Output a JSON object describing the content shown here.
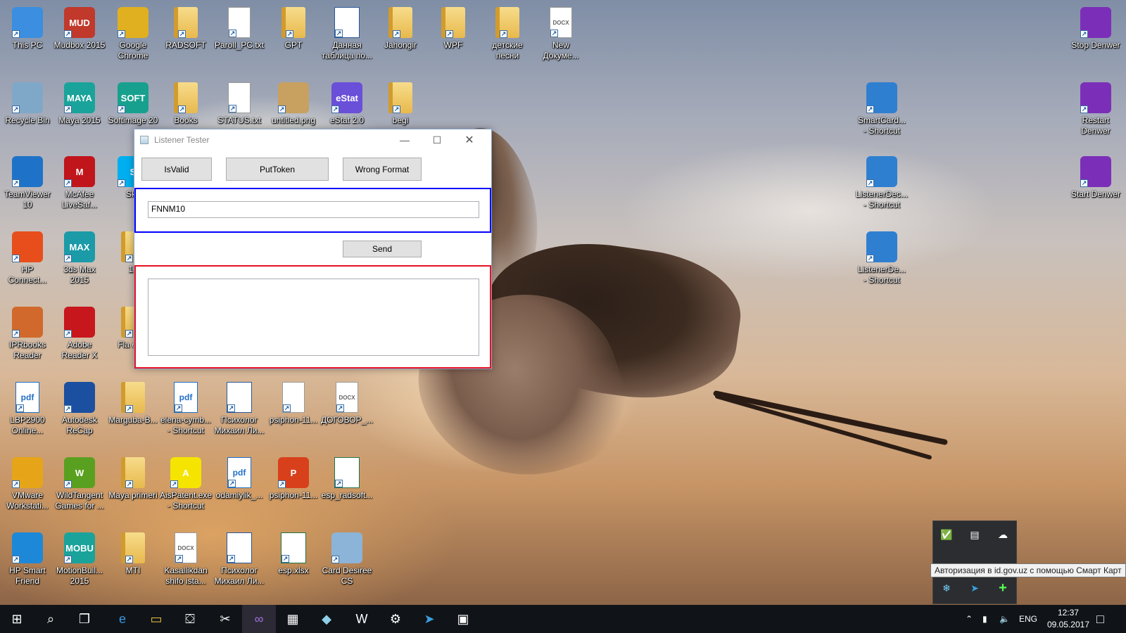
{
  "desktop_icons": [
    {
      "label": "This PC",
      "icon": "this-pc-icon"
    },
    {
      "label": "Mudbox 2015",
      "icon": "mudbox-icon",
      "badge": "MUD"
    },
    {
      "label": "Google Chrome",
      "icon": "chrome-icon"
    },
    {
      "label": "RADSOFT",
      "icon": "folder-icon"
    },
    {
      "label": "Paroll_PC.txt",
      "icon": "text-file-icon"
    },
    {
      "label": "GPT",
      "icon": "folder-icon"
    },
    {
      "label": "Данная таблица по...",
      "icon": "word-doc-icon"
    },
    {
      "label": "Jahongir",
      "icon": "folder-icon"
    },
    {
      "label": "WPF",
      "icon": "folder-icon"
    },
    {
      "label": "детские песни",
      "icon": "folder-icon"
    },
    {
      "label": "New Докуме...",
      "icon": "docx-icon",
      "badge": "DOCX"
    },
    {
      "label": "Stop Denwer",
      "icon": "denwer-stop-icon"
    },
    {
      "label": "Recycle Bin",
      "icon": "recycle-bin-icon"
    },
    {
      "label": "Maya 2015",
      "icon": "maya-icon",
      "badge": "MAYA"
    },
    {
      "label": "Softimage 20",
      "icon": "softimage-icon",
      "badge": "SOFT"
    },
    {
      "label": "Books",
      "icon": "folder-icon"
    },
    {
      "label": "STATUS.txt",
      "icon": "text-file-icon"
    },
    {
      "label": "untitled.png",
      "icon": "image-file-icon"
    },
    {
      "label": "eStat 2.0",
      "icon": "estat-icon",
      "badge": "eStat"
    },
    {
      "label": "begi",
      "icon": "folder-icon"
    },
    {
      "label": "SmartCard... - Shortcut",
      "icon": "app-window-icon"
    },
    {
      "label": "Restart Denwer",
      "icon": "denwer-restart-icon"
    },
    {
      "label": "TeamViewer 10",
      "icon": "teamviewer-icon"
    },
    {
      "label": "McAfee LiveSaf...",
      "icon": "mcafee-icon",
      "badge": "M"
    },
    {
      "label": "Sky",
      "icon": "skype-icon",
      "badge": "S"
    },
    {
      "label": "ListenerDec... - Shortcut",
      "icon": "app-window-icon"
    },
    {
      "label": "Start Denwer",
      "icon": "denwer-start-icon"
    },
    {
      "label": "HP Connect...",
      "icon": "hp-connect-icon"
    },
    {
      "label": "3ds Max 2015",
      "icon": "3dsmax-icon",
      "badge": "MAX"
    },
    {
      "label": "12",
      "icon": "folder-icon"
    },
    {
      "label": "ListenerDe... - Shortcut",
      "icon": "app-window-icon"
    },
    {
      "label": "IPRbooks Reader",
      "icon": "iprbooks-icon"
    },
    {
      "label": "Adobe Reader X",
      "icon": "adobe-reader-icon"
    },
    {
      "label": "Fla exar",
      "icon": "folder-icon"
    },
    {
      "label": "LBP2900 Online...",
      "icon": "pdf-file-icon",
      "badge": "pdf"
    },
    {
      "label": "Autodesk ReCap",
      "icon": "recap-icon"
    },
    {
      "label": "Marguba-B...",
      "icon": "folder-icon"
    },
    {
      "label": "elena-cymb... - Shortcut",
      "icon": "pdf-file-icon",
      "badge": "pdf"
    },
    {
      "label": "Психолог Михаил Ли...",
      "icon": "word-doc-icon"
    },
    {
      "label": "psiphon-11...",
      "icon": "blank-file-icon"
    },
    {
      "label": "ДОГОВОР_...",
      "icon": "docx-icon",
      "badge": "DOCX"
    },
    {
      "label": "VMware Workstati...",
      "icon": "vmware-icon"
    },
    {
      "label": "WildTangent Games for ...",
      "icon": "wildtangent-icon",
      "badge": "W"
    },
    {
      "label": "Maya primeri",
      "icon": "folder-icon"
    },
    {
      "label": "AisPatent.exe - Shortcut",
      "icon": "aispatent-icon",
      "badge": "A"
    },
    {
      "label": "odamiylik_...",
      "icon": "pdf-file-icon",
      "badge": "pdf"
    },
    {
      "label": "psiphon-11...",
      "icon": "psiphon-icon",
      "badge": "P"
    },
    {
      "label": "esp_radsoft...",
      "icon": "excel-file-icon"
    },
    {
      "label": "HP Smart Friend",
      "icon": "hp-smart-friend-icon"
    },
    {
      "label": "MotionBuil... 2015",
      "icon": "motionbuilder-icon",
      "badge": "MOBU"
    },
    {
      "label": "MTI",
      "icon": "folder-icon"
    },
    {
      "label": "Kasallikdan shifo ista...",
      "icon": "docx-icon",
      "badge": "DOCX"
    },
    {
      "label": "Психолог Михаил Ли...",
      "icon": "word-doc-icon"
    },
    {
      "label": "esp.xlsx",
      "icon": "excel-file-icon"
    },
    {
      "label": "Card Desiree CS",
      "icon": "card-desiree-icon"
    }
  ],
  "window": {
    "title": "Listener Tester",
    "buttons": {
      "isvalid": "IsValid",
      "puttoken": "PutToken",
      "wrong_format": "Wrong Format",
      "send": "Send"
    },
    "input_value": "FNNM10",
    "output_value": "",
    "panel_colors": {
      "input": "#0000ff",
      "output": "#e81123"
    }
  },
  "taskbar": {
    "apps": [
      "start-icon",
      "search-icon",
      "task-view-icon",
      "edge-icon",
      "file-explorer-icon",
      "store-icon",
      "tools-icon",
      "visual-studio-icon",
      "calculator-icon",
      "notes-app-icon",
      "word-icon",
      "settings-icon",
      "telegram-icon",
      "remote-app-icon"
    ],
    "language": "ENG",
    "time": "12:37",
    "date": "09.05.2017"
  },
  "tray_overflow": {
    "tooltip": "Авторизация в id.gov.uz с помощью Смарт Карт"
  }
}
